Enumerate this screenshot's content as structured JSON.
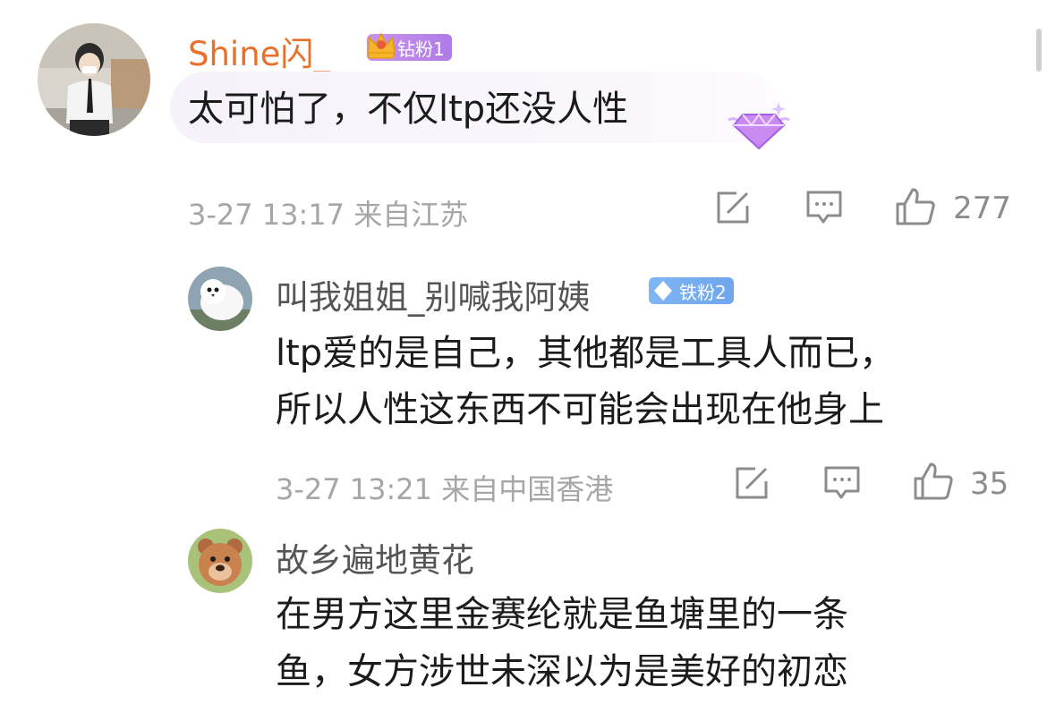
{
  "comments": [
    {
      "username": "Shine闪_",
      "badge": "钻粉1",
      "text": "太可怕了，不仅ltp还没人性",
      "meta": "3-27 13:17  来自江苏",
      "likes": "277",
      "username_color": "#e8702a"
    },
    {
      "username": "叫我姐姐_别喊我阿姨",
      "badge": "铁粉2",
      "text_lines": [
        "ltp爱的是自己，其他都是工具人而已，",
        "所以人性这东西不可能会出现在他身上"
      ],
      "meta": "3-27 13:21  来自中国香港",
      "likes": "35"
    },
    {
      "username": "故乡遍地黄花",
      "text_lines": [
        "在男方这里金赛纶就是鱼塘里的一条",
        "鱼，女方涉世未深以为是美好的初恋"
      ]
    }
  ],
  "icons": {
    "share": "share-icon",
    "comment": "comment-icon",
    "like": "thumbs-up-icon",
    "crown": "crown-icon",
    "diamond": "diamond-icon"
  },
  "colors": {
    "badge_purple": "#b98ae9",
    "badge_blue": "#74abef",
    "meta_gray": "#a6a6a6"
  }
}
